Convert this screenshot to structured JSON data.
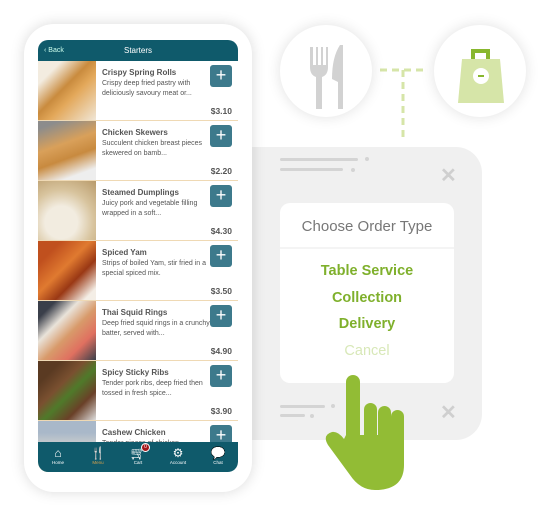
{
  "phone": {
    "header": {
      "back_label": "Back",
      "title": "Starters"
    },
    "items": [
      {
        "name": "Crispy Spring Rolls",
        "desc": "Crispy deep fried pastry with deliciously savoury meat or...",
        "price": "$3.10",
        "img": "linear-gradient(135deg,#f3ece0 20%,#c98b3e 45%,#e3a85a 60%,#f0e6d6)"
      },
      {
        "name": "Chicken Skewers",
        "desc": "Succulent chicken breast pieces skewered on bamb...",
        "price": "$2.20",
        "img": "linear-gradient(160deg,#8c8c8c 10%,#d9a05a 40%,#c88a3f 60%,#eee 85%)"
      },
      {
        "name": "Steamed Dumplings",
        "desc": "Juicy pork and vegetable filling wrapped in a soft...",
        "price": "$4.30",
        "img": "radial-gradient(circle at 40% 70%,#f2ece0 30%,#d8c49e 60%,#b89a6a)"
      },
      {
        "name": "Spiced Yam",
        "desc": "Strips of boiled Yam, stir fried in a special spiced mix.",
        "price": "$3.50",
        "img": "linear-gradient(135deg,#c0501e 20%,#e07a30 45%,#9a3814 65%,#f4eee6 90%)"
      },
      {
        "name": "Thai Squid Rings",
        "desc": "Deep fried squid rings in a crunchy batter, served with...",
        "price": "$4.90",
        "img": "linear-gradient(135deg,#3a3f4a 15%,#e9e3da 35%,#d89a6a 55%,#e07060 75%,#3a3f4a)"
      },
      {
        "name": "Spicy Sticky Ribs",
        "desc": "Tender pork ribs, deep fried then tossed in fresh spice...",
        "price": "$3.90",
        "img": "linear-gradient(135deg,#5a3a22 20%,#7a5030 40%,#4f7a2a 55%,#6a4028 75%,#ddd)"
      },
      {
        "name": "Cashew Chicken",
        "desc": "Tender pieces of chicken...",
        "price": "",
        "img": "linear-gradient(180deg,#a9b8c9 20%,#e8e0d0 60%,#7a9a5a)"
      }
    ],
    "tabs": [
      {
        "label": "Home",
        "icon": "home-icon",
        "glyph": "⌂"
      },
      {
        "label": "Menu",
        "icon": "cutlery-icon",
        "glyph": "🍴",
        "active": true
      },
      {
        "label": "Cart",
        "icon": "cart-icon",
        "glyph": "🛒",
        "badge": "0"
      },
      {
        "label": "Account",
        "icon": "gear-icon",
        "glyph": "⚙"
      },
      {
        "label": "Chat",
        "icon": "chat-icon",
        "glyph": "💬"
      }
    ]
  },
  "dialog": {
    "title": "Choose Order Type",
    "options": [
      "Table Service",
      "Collection",
      "Delivery"
    ],
    "cancel": "Cancel"
  },
  "colors": {
    "teal": "#0f5a6b",
    "green": "#7fb02c",
    "hand": "#92bc35",
    "bag": "#d6e5a8"
  }
}
